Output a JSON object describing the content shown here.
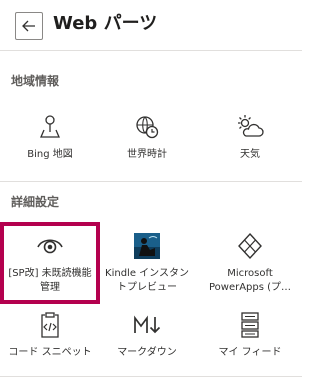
{
  "header": {
    "title": "Web パーツ"
  },
  "sections": [
    {
      "title": "地域情報",
      "items": [
        {
          "label": "Bing 地図",
          "icon": "map-pin-icon"
        },
        {
          "label": "世界時計",
          "icon": "world-clock-icon"
        },
        {
          "label": "天気",
          "icon": "weather-icon"
        }
      ]
    },
    {
      "title": "詳細設定",
      "items": [
        {
          "label": "[SP改] 未既読機能管理",
          "icon": "eye-icon",
          "selected": true
        },
        {
          "label": "Kindle インスタントプレビュー",
          "icon": "kindle-icon"
        },
        {
          "label": "Microsoft PowerApps (プ…",
          "icon": "powerapps-icon"
        },
        {
          "label": "コード スニペット",
          "icon": "code-snippet-icon"
        },
        {
          "label": "マークダウン",
          "icon": "markdown-icon"
        },
        {
          "label": "マイ フィード",
          "icon": "my-feed-icon"
        }
      ]
    }
  ],
  "colors": {
    "selection": "#b4004e",
    "text": "#323130",
    "section_title": "#605e5c"
  }
}
